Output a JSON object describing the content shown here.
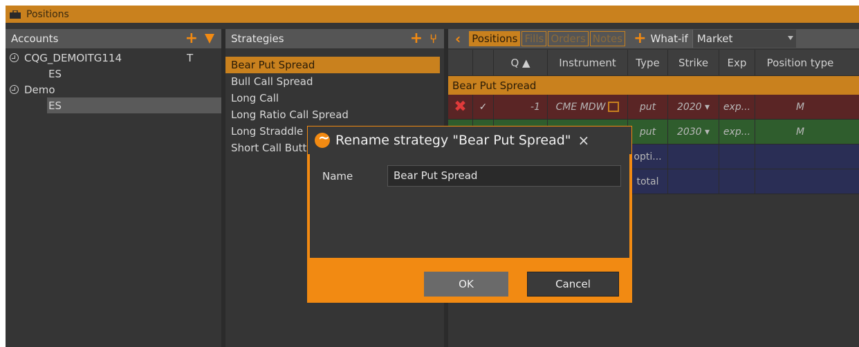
{
  "window": {
    "title": "Positions"
  },
  "accounts": {
    "header": "Accounts",
    "rows": [
      {
        "name": "CQG_DEMOITG114",
        "flag": "T"
      },
      {
        "name": "ES"
      },
      {
        "name": "Demo"
      },
      {
        "name": "ES"
      }
    ]
  },
  "strategies": {
    "header": "Strategies",
    "items": [
      "Bear Put Spread",
      "Bull Call Spread",
      "Long Call",
      "Long Ratio Call Spread",
      "Long Straddle",
      "Short Call Butterfly"
    ]
  },
  "right": {
    "tabs": [
      "Positions",
      "Fills",
      "Orders",
      "Notes"
    ],
    "whatif_label": "What-if",
    "market_value": "Market",
    "columns": [
      "Q",
      "Instrument",
      "Type",
      "Strike",
      "Exp",
      "Position type"
    ],
    "group_label": "Bear Put Spread",
    "rows": [
      {
        "qty": "-1",
        "instrument": "CME MDW",
        "type": "put",
        "strike": "2020",
        "exp": "exp...",
        "ptype": "M"
      },
      {
        "qty": "",
        "instrument": "",
        "type": "put",
        "strike": "2030",
        "exp": "exp...",
        "ptype": "M"
      },
      {
        "type": "opti..."
      },
      {
        "type": "total"
      }
    ]
  },
  "modal": {
    "title": "Rename strategy \"Bear Put Spread\"",
    "close": "×",
    "name_label": "Name",
    "name_value": "Bear Put Spread",
    "ok_label": "OK",
    "cancel_label": "Cancel"
  },
  "colors": {
    "accent": "#f28a12",
    "header_orange": "#c9811e",
    "panel_bg": "#353535"
  }
}
